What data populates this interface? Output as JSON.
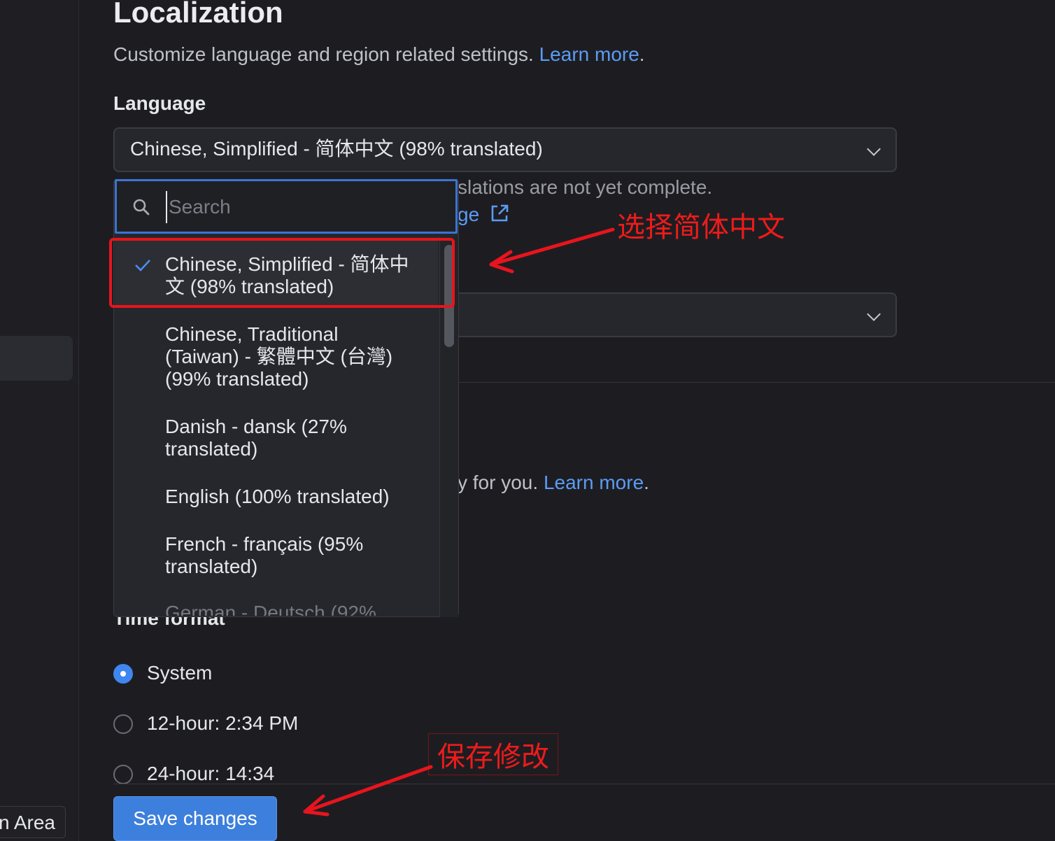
{
  "sidebar": {
    "footer_label": "n Area"
  },
  "header": {
    "title": "Localization",
    "description": "Customize language and region related settings.",
    "learn_more": "Learn more",
    "period": "."
  },
  "language": {
    "label": "Language",
    "selected": "Chinese, Simplified - 简体中文 (98% translated)",
    "help_text_partial": "slations are not yet complete.",
    "help_link_partial": "ge"
  },
  "dropdown": {
    "search_placeholder": "Search",
    "options": [
      {
        "label": "Chinese, Simplified - 简体中文 (98% translated)",
        "selected": true
      },
      {
        "label": "Chinese, Traditional (Taiwan) - 繁體中文 (台灣) (99% translated)",
        "selected": false
      },
      {
        "label": "Danish - dansk (27% translated)",
        "selected": false
      },
      {
        "label": "English (100% translated)",
        "selected": false
      },
      {
        "label": "French - français (95% translated)",
        "selected": false
      },
      {
        "label": "German - Deutsch (92%",
        "selected": false
      }
    ]
  },
  "region": {
    "help_text_partial": "y for you.",
    "learn_more": "Learn more",
    "period": "."
  },
  "time_format": {
    "label": "Time format",
    "options": [
      {
        "label": "System",
        "selected": true
      },
      {
        "label": "12-hour: 2:34 PM",
        "selected": false
      },
      {
        "label": "24-hour: 14:34",
        "selected": false
      }
    ]
  },
  "actions": {
    "save": "Save changes"
  },
  "annotations": {
    "select_note": "选择简体中文",
    "save_note": "保存修改",
    "color": "#ee1b1b"
  },
  "colors": {
    "accent": "#3d7fdc",
    "link": "#5b9cf5",
    "background": "#1d1d21"
  }
}
